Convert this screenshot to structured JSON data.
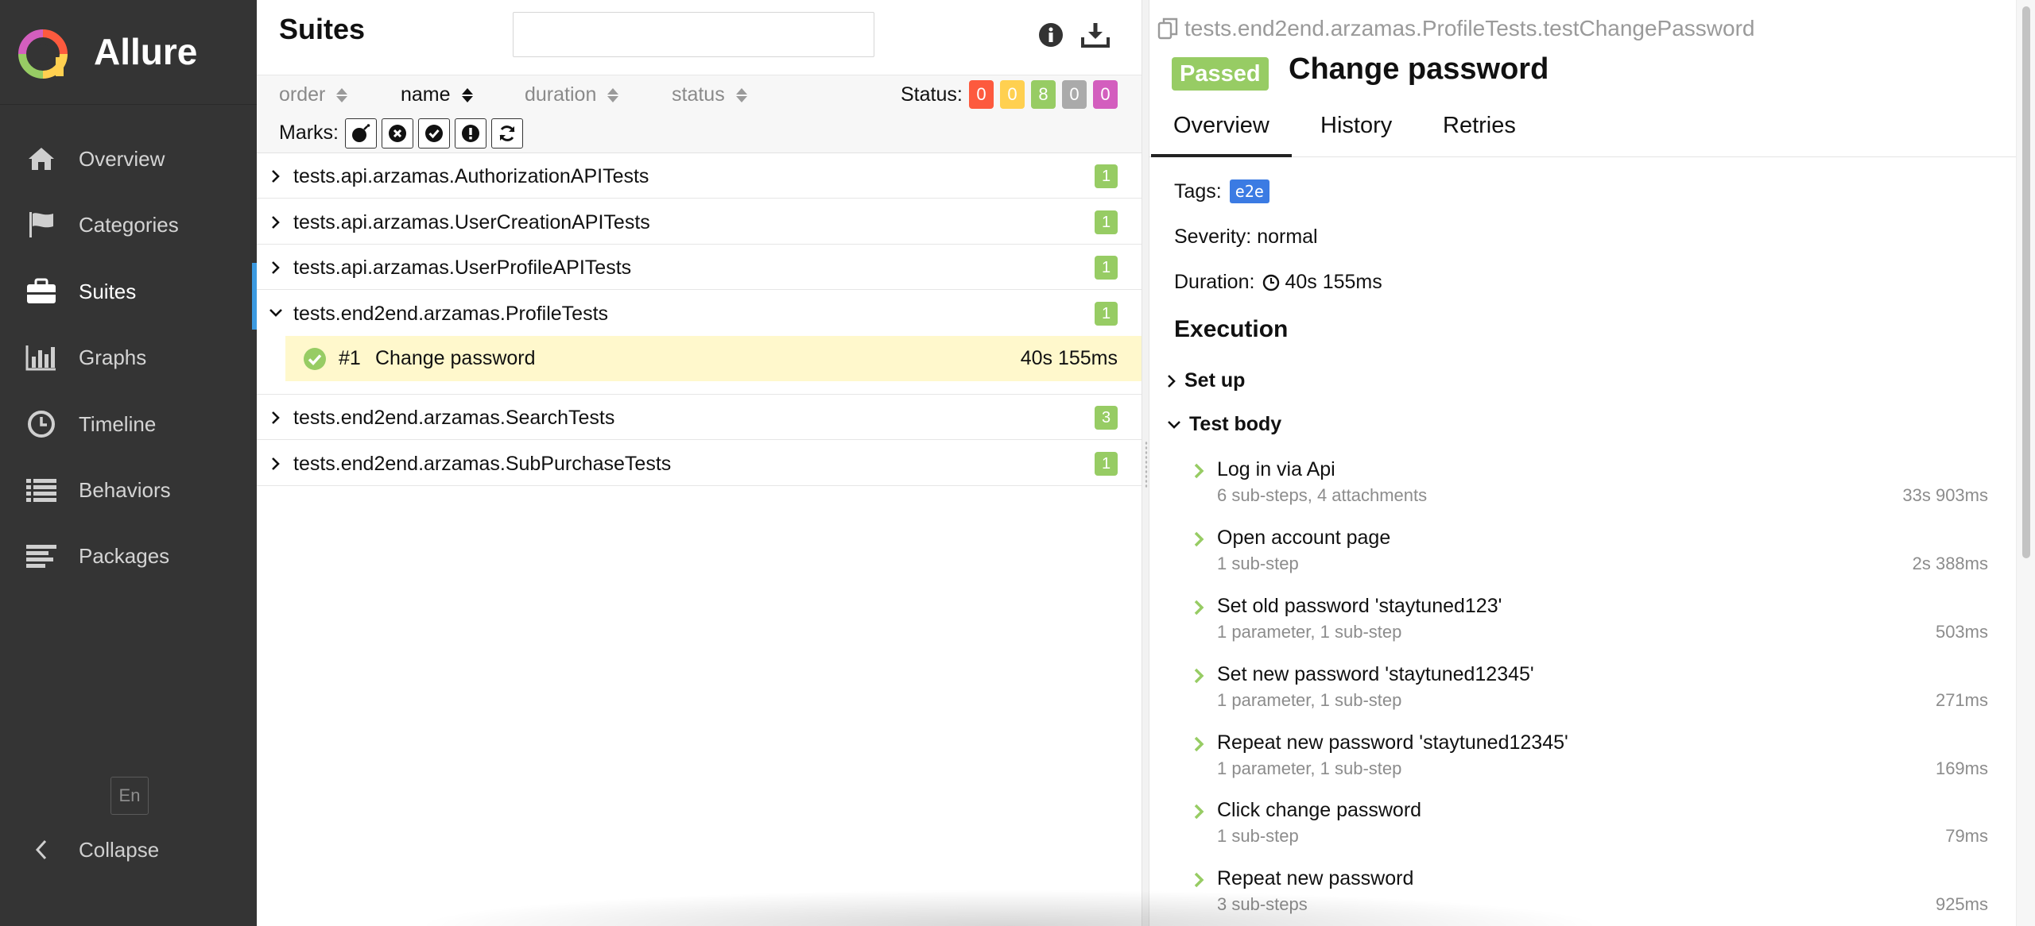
{
  "app": {
    "name": "Allure"
  },
  "sidebar": {
    "items": [
      {
        "label": "Overview",
        "icon": "home-icon"
      },
      {
        "label": "Categories",
        "icon": "flag-icon"
      },
      {
        "label": "Suites",
        "icon": "briefcase-icon",
        "active": true
      },
      {
        "label": "Graphs",
        "icon": "bar-chart-icon"
      },
      {
        "label": "Timeline",
        "icon": "clock-icon"
      },
      {
        "label": "Behaviors",
        "icon": "list-icon"
      },
      {
        "label": "Packages",
        "icon": "align-left-icon"
      }
    ],
    "language": "En",
    "collapse_label": "Collapse"
  },
  "suites": {
    "title": "Suites",
    "search": {
      "value": "",
      "placeholder": ""
    },
    "sort": {
      "order": "order",
      "name": "name",
      "duration": "duration",
      "status": "status",
      "active": "name"
    },
    "status_label": "Status:",
    "status_counts": [
      {
        "key": "failed",
        "value": "0",
        "color": "#fd5a3e"
      },
      {
        "key": "broken",
        "value": "0",
        "color": "#ffd050"
      },
      {
        "key": "passed",
        "value": "8",
        "color": "#97cc64"
      },
      {
        "key": "skipped",
        "value": "0",
        "color": "#aaaaaa"
      },
      {
        "key": "unknown",
        "value": "0",
        "color": "#d35ebe"
      }
    ],
    "marks_label": "Marks:",
    "marks": [
      "bomb-icon",
      "times-circle-icon",
      "check-circle-icon",
      "exclamation-circle-icon",
      "refresh-icon"
    ],
    "rows": [
      {
        "label": "tests.api.arzamas.AuthorizationAPITests",
        "count": "1",
        "expanded": false
      },
      {
        "label": "tests.api.arzamas.UserCreationAPITests",
        "count": "1",
        "expanded": false
      },
      {
        "label": "tests.api.arzamas.UserProfileAPITests",
        "count": "1",
        "expanded": false
      },
      {
        "label": "tests.end2end.arzamas.ProfileTests",
        "count": "1",
        "expanded": true
      },
      {
        "label": "tests.end2end.arzamas.SearchTests",
        "count": "3",
        "expanded": false
      },
      {
        "label": "tests.end2end.arzamas.SubPurchaseTests",
        "count": "1",
        "expanded": false
      }
    ],
    "test": {
      "id": "#1",
      "name": "Change password",
      "duration": "40s 155ms"
    }
  },
  "details": {
    "breadcrumb": "tests.end2end.arzamas.ProfileTests.testChangePassword",
    "status": "Passed",
    "title": "Change password",
    "tabs": [
      "Overview",
      "History",
      "Retries"
    ],
    "tags_label": "Tags:",
    "tag": "e2e",
    "severity": "Severity: normal",
    "duration_label": "Duration:",
    "duration": "40s 155ms",
    "execution": "Execution",
    "setup": "Set up",
    "body": "Test body",
    "steps": [
      {
        "name": "Log in via Api",
        "meta": "6 sub-steps, 4 attachments",
        "duration": "33s 903ms"
      },
      {
        "name": "Open account page",
        "meta": "1 sub-step",
        "duration": "2s 388ms"
      },
      {
        "name": "Set old password 'staytuned123'",
        "meta": "1 parameter, 1 sub-step",
        "duration": "503ms"
      },
      {
        "name": "Set new password 'staytuned12345'",
        "meta": "1 parameter, 1 sub-step",
        "duration": "271ms"
      },
      {
        "name": "Repeat new password 'staytuned12345'",
        "meta": "1 parameter, 1 sub-step",
        "duration": "169ms"
      },
      {
        "name": "Click change password",
        "meta": "1 sub-step",
        "duration": "79ms"
      },
      {
        "name": "Repeat new password",
        "meta": "3 sub-steps",
        "duration": "925ms"
      }
    ]
  }
}
